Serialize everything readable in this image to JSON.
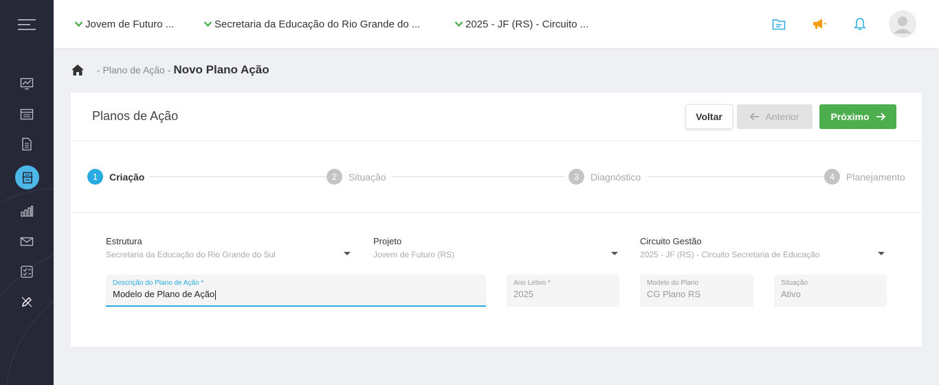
{
  "topbar": {
    "selectors": [
      {
        "label": "Jovem de Futuro ..."
      },
      {
        "label": "Secretaria da Educação do Rio Grande do ..."
      },
      {
        "label": "2025 - JF (RS) - Circuito ..."
      }
    ],
    "icons": [
      "folder-icon",
      "megaphone-icon",
      "bell-icon",
      "user-avatar"
    ],
    "colors": {
      "accent_blue": "#29abe2",
      "megaphone_orange": "#f39c12",
      "check_green": "#4cae4c"
    }
  },
  "sidebar": {
    "items": [
      {
        "icon": "dashboard-chart-icon"
      },
      {
        "icon": "calendar-icon"
      },
      {
        "icon": "document-icon"
      },
      {
        "icon": "action-plan-icon",
        "active": true
      },
      {
        "icon": "bar-chart-icon"
      },
      {
        "icon": "mail-icon"
      },
      {
        "icon": "checklist-icon"
      },
      {
        "icon": "edit-icon"
      }
    ]
  },
  "breadcrumb": {
    "parent": "- Plano de Ação -",
    "current": "Novo Plano Ação"
  },
  "card": {
    "title": "Planos de Ação",
    "buttons": {
      "voltar": "Voltar",
      "anterior": "Anterior",
      "proximo": "Próximo"
    }
  },
  "stepper": {
    "steps": [
      {
        "number": "1",
        "label": "Criação",
        "active": true
      },
      {
        "number": "2",
        "label": "Situação",
        "active": false
      },
      {
        "number": "3",
        "label": "Diagnóstico",
        "active": false
      },
      {
        "number": "4",
        "label": "Planejamento",
        "active": false
      }
    ]
  },
  "form": {
    "estrutura": {
      "label": "Estrutura",
      "value": "Secretaria da Educação do Rio Grande do Sul"
    },
    "projeto": {
      "label": "Projeto",
      "value": "Jovem de Futuro (RS)"
    },
    "circuito": {
      "label": "Circuito Gestão",
      "value": "2025 - JF (RS) - Circuito Secretaria de Educação"
    },
    "descricao": {
      "label": "Descrição do Plano de Ação *",
      "value": "Modelo de Plano de Ação"
    },
    "ano_letivo": {
      "label": "Ano Letivo *",
      "value": "2025"
    },
    "modelo": {
      "label": "Modelo do Plano",
      "value": "CG Plano RS"
    },
    "situacao": {
      "label": "Situação",
      "value": "Ativo"
    }
  }
}
